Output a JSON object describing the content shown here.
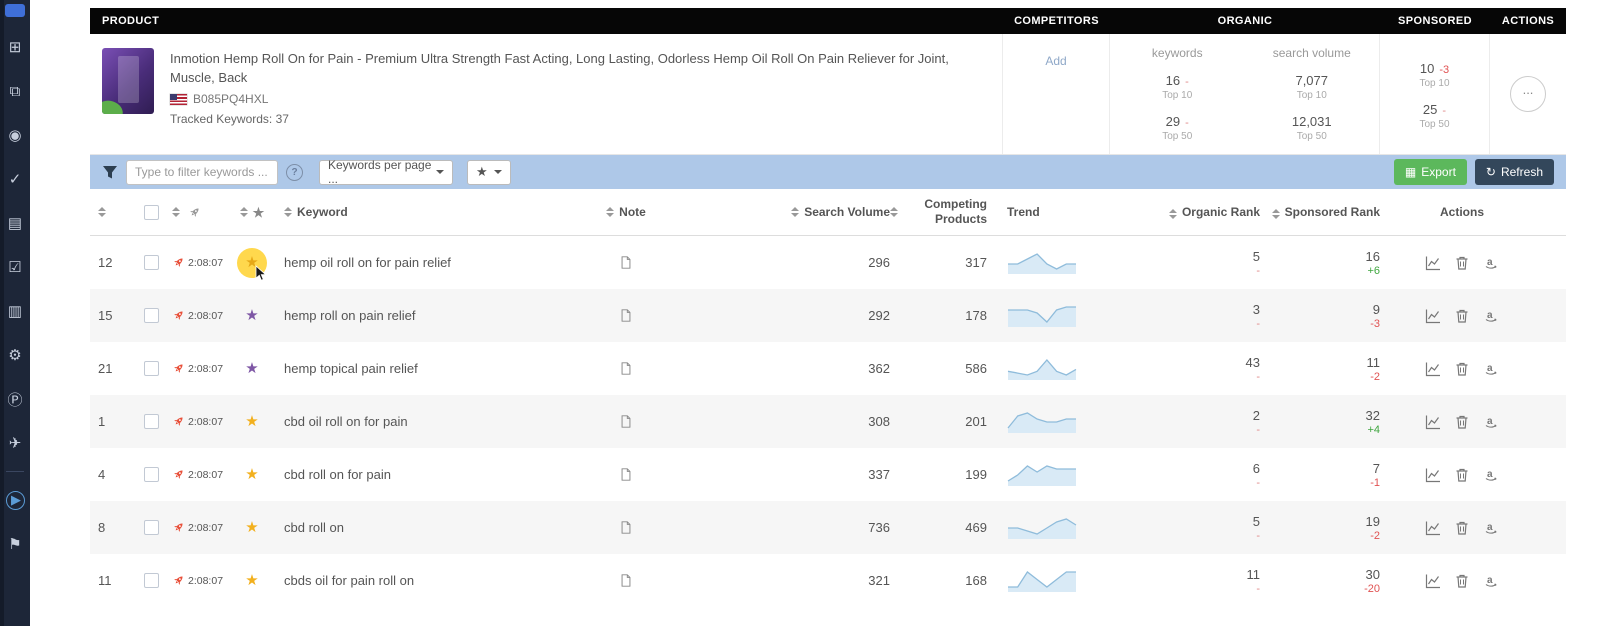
{
  "colors": {
    "filter_bar_bg": "#aec8e8",
    "export_green": "#5cb85c",
    "refresh_dark": "#33475b",
    "star_yellow": "#f2b01e",
    "star_yellow_highlighted": "#e6a817",
    "star_purple": "#7e57a5",
    "rocket_red": "#e8503a",
    "positive_green": "#3fa63f",
    "negative_red": "#e05252",
    "header_bg": "#060606",
    "sidebar_bg": "#1d2638",
    "trend_stroke": "#8fbcdb",
    "trend_fill": "#d9eaf6",
    "highlight_circle": "#ffd84d"
  },
  "icons": {
    "star": "★",
    "export": "▦",
    "refresh": "↻",
    "sidebar": {
      "grid": "⊞",
      "copy": "⧉",
      "camera": "◉",
      "check": "✓",
      "document": "▤",
      "tasks": "☑",
      "print": "▥",
      "gear": "⚙",
      "p_circle": "Ⓟ",
      "send": "✈",
      "play": "▶",
      "pin": "⚑"
    }
  },
  "section_header": {
    "product": "PRODUCT",
    "competitors": "COMPETITORS",
    "organic": "ORGANIC",
    "sponsored": "SPONSORED",
    "actions": "ACTIONS"
  },
  "product": {
    "title": "Inmotion Hemp Roll On for Pain - Premium Ultra Strength Fast Acting, Long Lasting, Odorless Hemp Oil Roll On Pain Reliever for Joint, Muscle, Back",
    "asin": "B085PQ4HXL",
    "tracked": "Tracked Keywords: 37",
    "competitors_add": "Add",
    "organic_keywords_header": "keywords",
    "organic_volume_header": "search volume",
    "organic_stats": [
      {
        "value": "16",
        "change": "-",
        "scope": "Top 10",
        "volume": "7,077",
        "volume_scope": "Top 10"
      },
      {
        "value": "29",
        "change": "-",
        "scope": "Top 50",
        "volume": "12,031",
        "volume_scope": "Top 50"
      }
    ],
    "sponsored_stats": [
      {
        "value": "10",
        "change": "-3",
        "scope": "Top 10"
      },
      {
        "value": "25",
        "change": "-",
        "scope": "Top 50"
      }
    ],
    "more_label": "..."
  },
  "filter_bar": {
    "search_placeholder": "Type to filter keywords ...",
    "help": "?",
    "per_page": "Keywords per page ...",
    "export": "Export",
    "refresh": "Refresh"
  },
  "table_header": {
    "keyword": "Keyword",
    "note": "Note",
    "search_volume": "Search Volume",
    "competing_products": "Competing Products",
    "trend": "Trend",
    "organic_rank": "Organic Rank",
    "sponsored_rank": "Sponsored Rank",
    "actions": "Actions"
  },
  "rows": [
    {
      "index": "12",
      "time": "2:08:07",
      "star": "yellow",
      "highlighted": true,
      "keyword": "hemp oil roll on for pain relief",
      "search_volume": "296",
      "competing_products": "317",
      "trend": [
        5,
        5,
        5.5,
        6,
        5,
        4.5,
        5,
        5
      ],
      "organic_rank": "5",
      "organic_change": "-",
      "sponsored_rank": "16",
      "sponsored_change": "+6"
    },
    {
      "index": "15",
      "time": "2:08:07",
      "star": "purple",
      "highlighted": false,
      "keyword": "hemp roll on pain relief",
      "search_volume": "292",
      "competing_products": "178",
      "trend": [
        5,
        5,
        5,
        4.5,
        3,
        5,
        5.5,
        5.5
      ],
      "organic_rank": "3",
      "organic_change": "-",
      "sponsored_rank": "9",
      "sponsored_change": "-3"
    },
    {
      "index": "21",
      "time": "2:08:07",
      "star": "purple",
      "highlighted": false,
      "keyword": "hemp topical pain relief",
      "search_volume": "362",
      "competing_products": "586",
      "trend": [
        4,
        3.5,
        3,
        4,
        7,
        4,
        3,
        4.5
      ],
      "organic_rank": "43",
      "organic_change": "-",
      "sponsored_rank": "11",
      "sponsored_change": "-2"
    },
    {
      "index": "1",
      "time": "2:08:07",
      "star": "yellow",
      "highlighted": false,
      "keyword": "cbd oil roll on for pain",
      "search_volume": "308",
      "competing_products": "201",
      "trend": [
        3.5,
        5.5,
        6,
        5,
        4.5,
        4.5,
        5,
        5
      ],
      "organic_rank": "2",
      "organic_change": "-",
      "sponsored_rank": "32",
      "sponsored_change": "+4"
    },
    {
      "index": "4",
      "time": "2:08:07",
      "star": "yellow",
      "highlighted": false,
      "keyword": "cbd roll on for pain",
      "search_volume": "337",
      "competing_products": "199",
      "trend": [
        3.5,
        4.5,
        6,
        5,
        6,
        5.5,
        5.5,
        5.5
      ],
      "organic_rank": "6",
      "organic_change": "-",
      "sponsored_rank": "7",
      "sponsored_change": "-1"
    },
    {
      "index": "8",
      "time": "2:08:07",
      "star": "yellow",
      "highlighted": false,
      "keyword": "cbd roll on",
      "search_volume": "736",
      "competing_products": "469",
      "trend": [
        4.5,
        4.5,
        4,
        3.5,
        4.5,
        5.5,
        6,
        5
      ],
      "organic_rank": "5",
      "organic_change": "-",
      "sponsored_rank": "19",
      "sponsored_change": "-2"
    },
    {
      "index": "11",
      "time": "2:08:07",
      "star": "yellow",
      "highlighted": false,
      "keyword": "cbds oil for pain roll on",
      "search_volume": "321",
      "competing_products": "168",
      "trend": [
        4.5,
        4.5,
        5.5,
        5,
        4.5,
        5,
        5.5,
        5.5
      ],
      "organic_rank": "11",
      "organic_change": "-",
      "sponsored_rank": "30",
      "sponsored_change": "-20"
    }
  ]
}
